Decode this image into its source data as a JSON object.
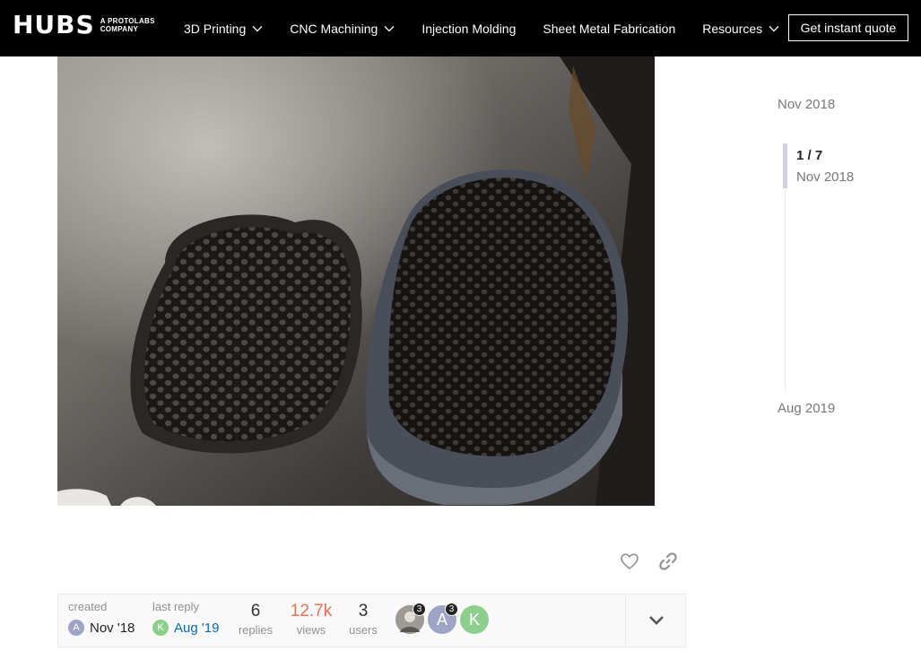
{
  "header": {
    "logo_text": "HUBS",
    "logo_sub_line1": "A PROTOLABS",
    "logo_sub_line2": "COMPANY",
    "nav": [
      {
        "label": "3D Printing",
        "has_dropdown": true
      },
      {
        "label": "CNC Machining",
        "has_dropdown": true
      },
      {
        "label": "Injection Molding",
        "has_dropdown": false
      },
      {
        "label": "Sheet Metal Fabrication",
        "has_dropdown": false
      },
      {
        "label": "Resources",
        "has_dropdown": true
      }
    ],
    "cta_label": "Get instant quote"
  },
  "topic_map": {
    "created_label": "created",
    "created_avatar": "A",
    "created_date": "Nov '18",
    "last_reply_label": "last reply",
    "last_reply_avatar": "K",
    "last_reply_date": "Aug '19",
    "replies_count": "6",
    "replies_label": "replies",
    "views_count": "12.7k",
    "views_label": "views",
    "users_count": "3",
    "users_label": "users",
    "participants": [
      {
        "initial": "",
        "badge": "3"
      },
      {
        "initial": "A",
        "badge": "3"
      },
      {
        "initial": "K",
        "badge": ""
      }
    ]
  },
  "timeline": {
    "start_date": "Nov 2018",
    "position": "1 / 7",
    "current_date": "Nov 2018",
    "end_date": "Aug 2019"
  },
  "colors": {
    "header_bg": "#000000",
    "views_hot": "#e45735",
    "avatar_a": "#a0a4c4",
    "avatar_k": "#8ccf8c"
  }
}
